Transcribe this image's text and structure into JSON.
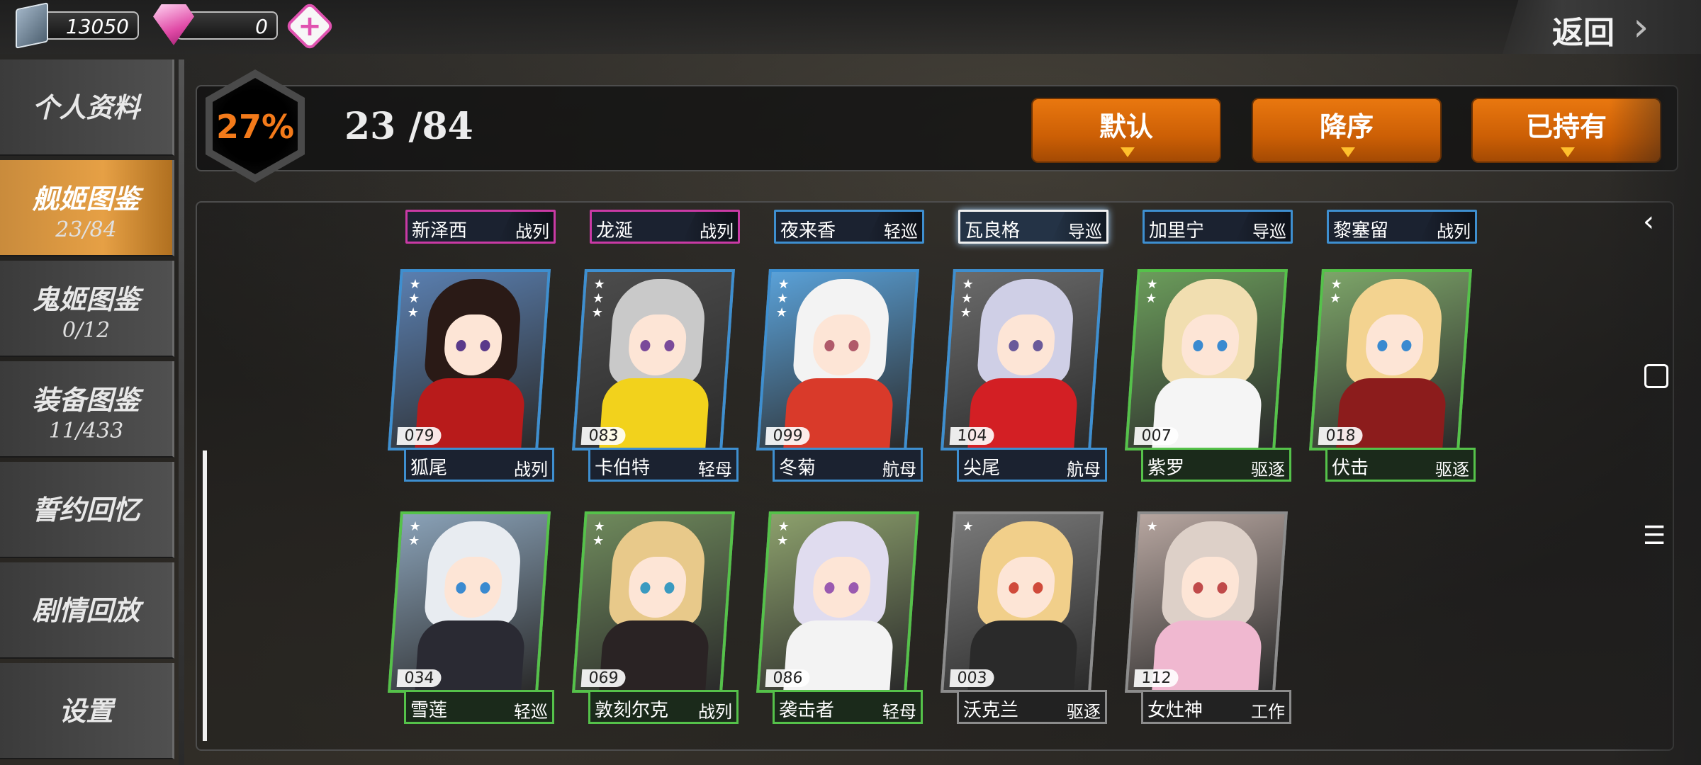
{
  "resources": {
    "oil": "13050",
    "gems": "0"
  },
  "back_label": "返回",
  "sidebar": {
    "items": [
      {
        "label": "个人资料",
        "count": ""
      },
      {
        "label": "舰姬图鉴",
        "count": "23/84"
      },
      {
        "label": "鬼姬图鉴",
        "count": "0/12"
      },
      {
        "label": "装备图鉴",
        "count": "11/433"
      },
      {
        "label": "誓约回忆",
        "count": ""
      },
      {
        "label": "剧情回放",
        "count": ""
      },
      {
        "label": "设置",
        "count": ""
      }
    ]
  },
  "header": {
    "percent": "27%",
    "count": "23 /84",
    "sort_buttons": [
      "默认",
      "降序",
      "已持有"
    ]
  },
  "top_tags": [
    {
      "name": "新泽西",
      "type": "战列"
    },
    {
      "name": "龙涎",
      "type": "战列"
    },
    {
      "name": "夜来香",
      "type": "轻巡"
    },
    {
      "name": "瓦良格",
      "type": "导巡"
    },
    {
      "name": "加里宁",
      "type": "导巡"
    },
    {
      "name": "黎塞留",
      "type": "战列"
    }
  ],
  "cards": [
    {
      "num": "079",
      "name": "狐尾",
      "type": "战列",
      "stars": 3
    },
    {
      "num": "083",
      "name": "卡伯特",
      "type": "轻母",
      "stars": 3
    },
    {
      "num": "099",
      "name": "冬菊",
      "type": "航母",
      "stars": 3
    },
    {
      "num": "104",
      "name": "尖尾",
      "type": "航母",
      "stars": 3
    },
    {
      "num": "007",
      "name": "紫罗",
      "type": "驱逐",
      "stars": 2
    },
    {
      "num": "018",
      "name": "伏击",
      "type": "驱逐",
      "stars": 2
    },
    {
      "num": "034",
      "name": "雪莲",
      "type": "轻巡",
      "stars": 2
    },
    {
      "num": "069",
      "name": "敦刻尔克",
      "type": "战列",
      "stars": 2
    },
    {
      "num": "086",
      "name": "袭击者",
      "type": "轻母",
      "stars": 2
    },
    {
      "num": "003",
      "name": "沃克兰",
      "type": "驱逐",
      "stars": 1
    },
    {
      "num": "112",
      "name": "女灶神",
      "type": "工作",
      "stars": 1
    }
  ],
  "colors": {
    "accent": "#f37a1a",
    "sort_button": "#cc5f05",
    "active_tab": "#e6a045"
  }
}
